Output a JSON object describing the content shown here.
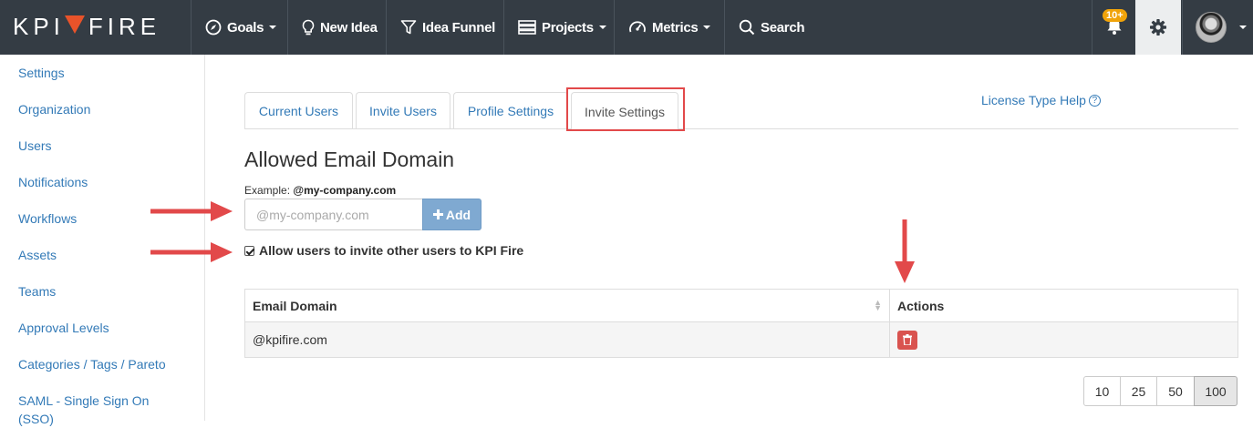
{
  "nav": {
    "logo_left": "KPI",
    "logo_right": "FIRE",
    "goals": "Goals",
    "new_idea": "New Idea",
    "idea_funnel": "Idea Funnel",
    "projects": "Projects",
    "metrics": "Metrics",
    "search": "Search",
    "notif_badge": "10+"
  },
  "sidebar": {
    "items": [
      {
        "label": "Settings"
      },
      {
        "label": "Organization"
      },
      {
        "label": "Users"
      },
      {
        "label": "Notifications"
      },
      {
        "label": "Workflows"
      },
      {
        "label": "Assets"
      },
      {
        "label": "Teams"
      },
      {
        "label": "Approval Levels"
      },
      {
        "label": "Categories / Tags / Pareto"
      },
      {
        "label": "SAML - Single Sign On (SSO)"
      }
    ]
  },
  "tabs": [
    {
      "label": "Current Users"
    },
    {
      "label": "Invite Users"
    },
    {
      "label": "Profile Settings"
    },
    {
      "label": "Invite Settings",
      "active": true
    }
  ],
  "license_help": "License Type Help",
  "section": {
    "title": "Allowed Email Domain",
    "example_prefix": "Example:",
    "example_value": "@my-company.com",
    "input_placeholder": "@my-company.com",
    "add_label": "Add",
    "allow_invite_label": "Allow users to invite other users to KPI Fire",
    "allow_invite_checked": true
  },
  "table": {
    "headers": [
      "Email Domain",
      "Actions"
    ],
    "rows": [
      {
        "domain": "@kpifire.com"
      }
    ]
  },
  "pagination": [
    "10",
    "25",
    "50",
    "100"
  ],
  "pagination_selected": "100",
  "colors": {
    "topbar": "#343c44",
    "link": "#337ab7",
    "annotation_red": "#e2494a",
    "delete_red": "#d9534f",
    "add_button": "#7fa9d1"
  }
}
